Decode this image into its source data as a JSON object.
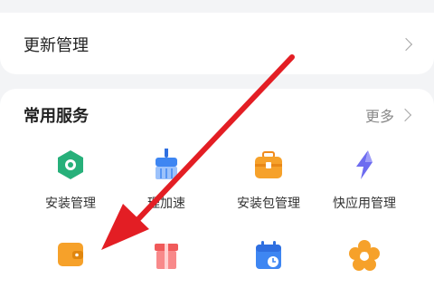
{
  "update": {
    "label": "更新管理"
  },
  "services": {
    "title": "常用服务",
    "more_label": "更多",
    "row1": [
      {
        "label": "安装管理",
        "icon": "install-manager-icon"
      },
      {
        "label": "理加速",
        "icon": "cleanup-accelerate-icon"
      },
      {
        "label": "安装包管理",
        "icon": "package-manager-icon"
      },
      {
        "label": "快应用管理",
        "icon": "quick-app-icon"
      }
    ],
    "row2": [
      {
        "icon": "wallet-icon"
      },
      {
        "icon": "gift-icon"
      },
      {
        "icon": "calendar-clock-icon"
      },
      {
        "icon": "flower-icon"
      }
    ]
  },
  "colors": {
    "annotation_arrow": "#e31e24",
    "background": "#f3f4f6"
  }
}
